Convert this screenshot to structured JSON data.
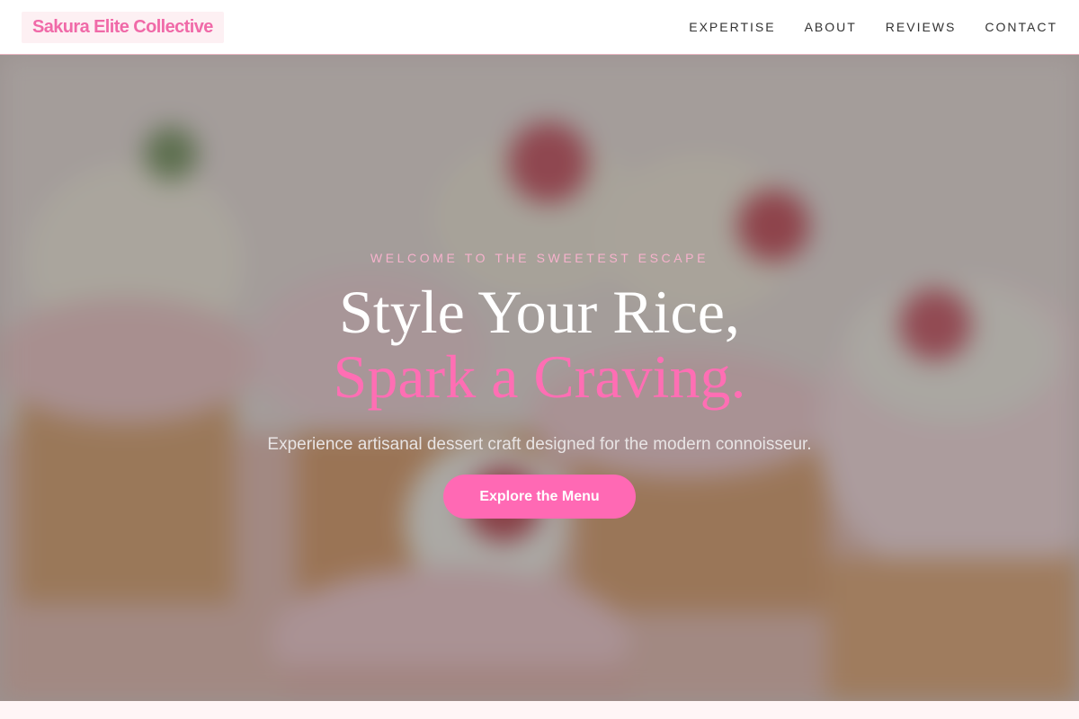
{
  "brand": {
    "name": "Sakura Elite Collective"
  },
  "nav": {
    "items": [
      {
        "label": "EXPERTISE"
      },
      {
        "label": "ABOUT"
      },
      {
        "label": "REVIEWS"
      },
      {
        "label": "CONTACT"
      }
    ]
  },
  "hero": {
    "eyebrow": "WELCOME TO THE SWEETEST ESCAPE",
    "headline_line1": "Style Your Rice,",
    "headline_line2": "Spark a Craving.",
    "subtitle": "Experience artisanal dessert craft designed for the modern connoisseur.",
    "cta_label": "Explore the Menu"
  },
  "colors": {
    "accent": "#ff69b4",
    "brand_text": "#f06aa8",
    "eyebrow": "#f6b2cc",
    "page_bg": "#fff5f6"
  }
}
